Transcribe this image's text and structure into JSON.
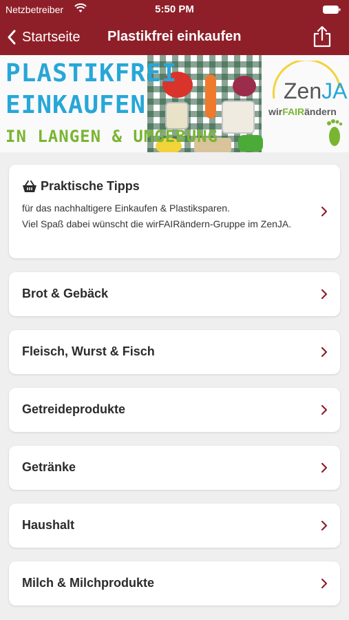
{
  "status_bar": {
    "carrier": "Netzbetreiber",
    "time": "5:50 PM"
  },
  "nav": {
    "back_label": "Startseite",
    "title": "Plastikfrei einkaufen"
  },
  "banner": {
    "line1": "PLASTIKFREI",
    "line2": "EINKAUFEN",
    "line3": "IN LANGEN & UMGEBUNG",
    "logo_zen": "Zen",
    "logo_ja": "JA",
    "logo_wir": "wir",
    "logo_fair": "FAIR",
    "logo_andern": "ändern"
  },
  "tips": {
    "title": "Praktische Tipps",
    "line1": "für das nachhaltigere Einkaufen & Plastiksparen.",
    "line2": "Viel Spaß dabei wünscht die wirFAIRändern-Gruppe im ZenJA."
  },
  "categories": [
    "Brot & Gebäck",
    "Fleisch, Wurst & Fisch",
    "Getreideprodukte",
    "Getränke",
    "Haushalt",
    "Milch & Milchprodukte"
  ],
  "colors": {
    "header": "#8e1f28",
    "chevron": "#8e1f28",
    "background": "#efefef"
  }
}
